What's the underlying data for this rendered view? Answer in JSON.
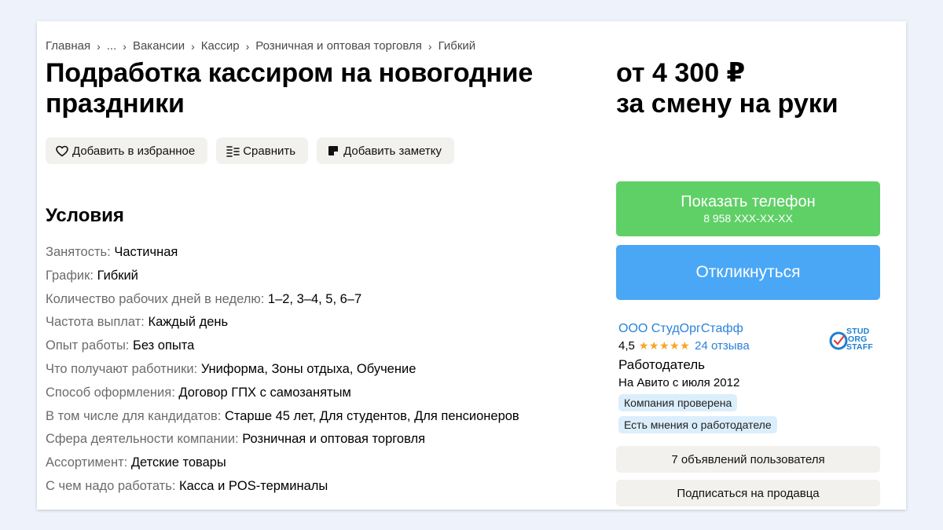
{
  "breadcrumb": [
    "Главная",
    "...",
    "Вакансии",
    "Кассир",
    "Розничная и оптовая торговля",
    "Гибкий"
  ],
  "title": "Подработка кассиром на новогодние праздники",
  "price": {
    "line1": "от 4 300 ₽",
    "line2": "за смену на руки"
  },
  "actions": {
    "favorite": "Добавить в избранное",
    "compare": "Сравнить",
    "note": "Добавить заметку"
  },
  "conditions": {
    "title": "Условия",
    "items": [
      {
        "label": "Занятость:",
        "value": "Частичная"
      },
      {
        "label": "График:",
        "value": "Гибкий"
      },
      {
        "label": "Количество рабочих дней в неделю:",
        "value": "1–2, 3–4, 5, 6–7"
      },
      {
        "label": "Частота выплат:",
        "value": "Каждый день"
      },
      {
        "label": "Опыт работы:",
        "value": "Без опыта"
      },
      {
        "label": "Что получают работники:",
        "value": "Униформа, Зоны отдыха, Обучение"
      },
      {
        "label": "Способ оформления:",
        "value": "Договор ГПХ с самозанятым"
      },
      {
        "label": "В том числе для кандидатов:",
        "value": "Старше 45 лет, Для студентов, Для пенсионеров"
      },
      {
        "label": "Сфера деятельности компании:",
        "value": "Розничная и оптовая торговля"
      },
      {
        "label": "Ассортимент:",
        "value": "Детские товары"
      },
      {
        "label": "С чем надо работать:",
        "value": "Касса и POS-терминалы"
      }
    ]
  },
  "contact": {
    "show_phone": "Показать телефон",
    "phone_masked": "8 958 XXX-XX-XX",
    "respond": "Откликнуться"
  },
  "seller": {
    "name": "ООО СтудОргСтафф",
    "rating": "4,5",
    "stars": "★★★★★",
    "reviews": "24 отзыва",
    "role": "Работодатель",
    "since": "На Авито с июля 2012",
    "badges": [
      "Компания проверена",
      "Есть мнения о работодателе"
    ],
    "logo_text": [
      "STUD",
      "ORG",
      "STAFF"
    ],
    "listings_button": "7 объявлений пользователя",
    "subscribe_button": "Подписаться на продавца"
  },
  "colors": {
    "phone_button": "#5fd066",
    "respond_button": "#4aa7f5",
    "link": "#2b82d9",
    "star": "#f5a623",
    "badge_bg": "#dbeefc"
  }
}
